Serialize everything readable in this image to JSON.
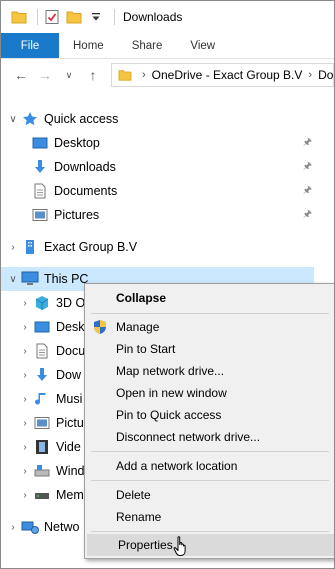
{
  "window": {
    "title": "Downloads"
  },
  "ribbon": {
    "tabs": [
      "File",
      "Home",
      "Share",
      "View"
    ]
  },
  "address": {
    "segments": [
      "OneDrive - Exact Group B.V",
      "Dow"
    ]
  },
  "tree": {
    "quick_access": "Quick access",
    "qa_items": [
      "Desktop",
      "Downloads",
      "Documents",
      "Pictures"
    ],
    "exact": "Exact Group B.V",
    "this_pc": "This PC",
    "pc_items": [
      "3D O",
      "Desk",
      "Docu",
      "Dow",
      "Musi",
      "Pictu",
      "Vide",
      "Wind",
      "Mem"
    ],
    "network": "Netwo"
  },
  "context_menu": {
    "collapse": "Collapse",
    "manage": "Manage",
    "pin_start": "Pin to Start",
    "map_drive": "Map network drive...",
    "open_window": "Open in new window",
    "pin_quick": "Pin to Quick access",
    "disconnect": "Disconnect network drive...",
    "add_location": "Add a network location",
    "delete": "Delete",
    "rename": "Rename",
    "properties": "Properties"
  },
  "colors": {
    "accent": "#1979ca",
    "selection": "#cce8ff",
    "menu_bg": "#f0f0f0",
    "menu_hover": "#dadada"
  }
}
